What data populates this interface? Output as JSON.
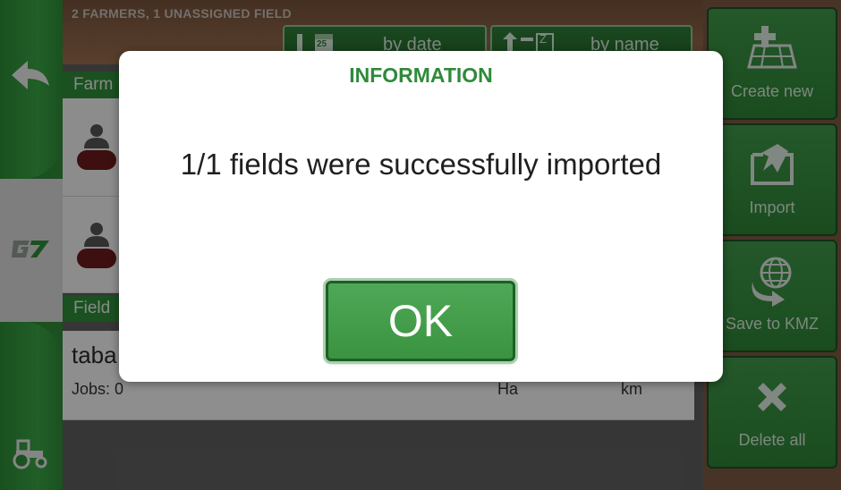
{
  "header": {
    "info": "2 FARMERS, 1 UNASSIGNED FIELD"
  },
  "sort": {
    "by_date_label": "by date",
    "by_name_label": "by name",
    "calendar_day": "25",
    "name_icon_letter": "Z"
  },
  "farmers_section": {
    "label": "Farm"
  },
  "fields_section": {
    "label": "Field"
  },
  "field": {
    "name": "taba",
    "jobs": "Jobs: 0",
    "area_unit": "Ha",
    "length_unit": "km"
  },
  "left_rail": {
    "brand": "G7"
  },
  "actions": [
    {
      "label": "Create new",
      "icon": "add-field-icon"
    },
    {
      "label": "Import",
      "icon": "import-icon"
    },
    {
      "label": "Save to KMZ",
      "icon": "globe-export-icon"
    },
    {
      "label": "Delete all",
      "icon": "delete-x-icon"
    }
  ],
  "dialog": {
    "title": "INFORMATION",
    "message": "1/1 fields were successfully imported",
    "ok_label": "OK"
  },
  "colors": {
    "accent_green": "#2f8a3a",
    "brown": "#7a5a44"
  }
}
